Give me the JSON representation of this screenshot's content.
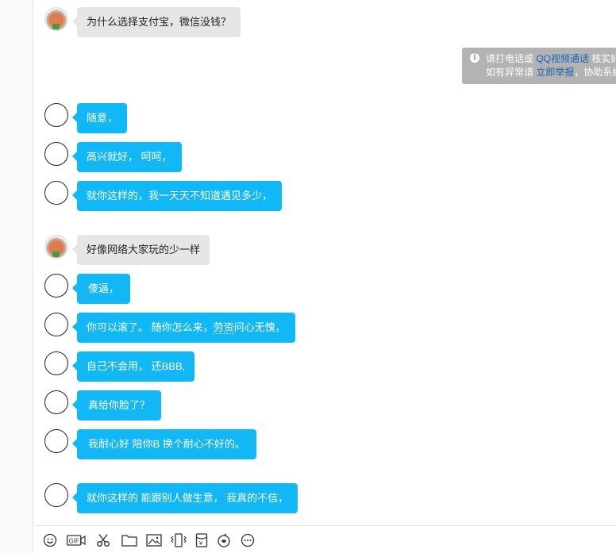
{
  "messages": [
    {
      "side": "other",
      "avatar": "photo",
      "text": "为什么选择支付宝，微信没钱？"
    },
    {
      "side": "me",
      "avatar": "empty",
      "text": "随意，"
    },
    {
      "side": "me",
      "avatar": "empty",
      "text": "高兴就好， 呵呵，"
    },
    {
      "side": "me",
      "avatar": "empty",
      "text": "就你这样的，我一天天不知道遇见多少，"
    },
    {
      "side": "other",
      "avatar": "photo",
      "text": "好像网络大家玩的少一样"
    },
    {
      "side": "me",
      "avatar": "empty",
      "text": "傻逼，"
    },
    {
      "side": "me",
      "avatar": "empty",
      "text_before": "你可以滚了。 随你怎么来，",
      "text_underlined": "劳资",
      "text_after": "问心无愧，"
    },
    {
      "side": "me",
      "avatar": "empty",
      "text": "自己不会用， 还BBB,"
    },
    {
      "side": "me",
      "avatar": "empty",
      "text": "真给你脸了？"
    },
    {
      "side": "me",
      "avatar": "empty",
      "text": "我耐心好  陪你B 换个耐心不好的。"
    },
    {
      "side": "me",
      "avatar": "empty",
      "text": "就你这样的 能跟别人做生意， 我真的不信，"
    }
  ],
  "notice": {
    "line1_before": "请打电话或 ",
    "line1_link": "QQ视频通话",
    "line1_after": " 核实好",
    "line2_before": "如有异常请 ",
    "line2_link": "立即举报",
    "line2_after": "，协助系统"
  },
  "toolbar": [
    {
      "name": "emoji-icon",
      "label": "☺"
    },
    {
      "name": "gif-icon",
      "label": "GIF"
    },
    {
      "name": "scissors-icon",
      "label": "✂"
    },
    {
      "name": "folder-icon",
      "label": ""
    },
    {
      "name": "image-icon",
      "label": ""
    },
    {
      "name": "shake-icon",
      "label": ""
    },
    {
      "name": "redpacket-icon",
      "label": "¥"
    },
    {
      "name": "voice-icon",
      "label": ""
    },
    {
      "name": "more-icon",
      "label": "⋯"
    }
  ],
  "colors": {
    "bubble_blue": "#12b7f5",
    "bubble_gray": "#e6e6e6",
    "notice_bg": "#b3b3b3",
    "link": "#1264b5"
  }
}
